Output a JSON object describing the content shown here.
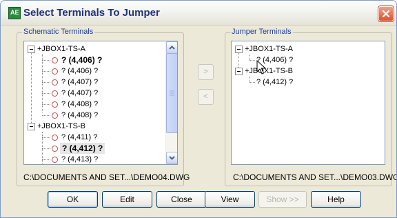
{
  "window": {
    "title": "Select Terminals To Jumper",
    "app_icon_glyph": "AE"
  },
  "schematic": {
    "group_label": "Schematic Terminals",
    "items": [
      {
        "label": "+JBOX1-TS-A",
        "kind": "parent"
      },
      {
        "label": "? (4,406) ?",
        "kind": "child",
        "bold": true
      },
      {
        "label": "? (4,406) ?",
        "kind": "child"
      },
      {
        "label": "? (4,407) ?",
        "kind": "child"
      },
      {
        "label": "? (4,407) ?",
        "kind": "child"
      },
      {
        "label": "? (4,408) ?",
        "kind": "child"
      },
      {
        "label": "? (4,408) ?",
        "kind": "child"
      },
      {
        "label": "+JBOX1-TS-B",
        "kind": "parent"
      },
      {
        "label": "? (4,411) ?",
        "kind": "child"
      },
      {
        "label": "? (4,412) ?",
        "kind": "child",
        "bold": true,
        "selected": true
      },
      {
        "label": "? (4,413) ?",
        "kind": "child"
      }
    ],
    "path": "C:\\DOCUMENTS AND SET...\\DEMO04.DWG"
  },
  "jumper": {
    "group_label": "Jumper Terminals",
    "items": [
      {
        "label": "+JBOX1-TS-A",
        "kind": "parent"
      },
      {
        "label": "? (4,406) ?",
        "kind": "child"
      },
      {
        "label": "+JBOX1-TS-B",
        "kind": "parent"
      },
      {
        "label": "? (4,412) ?",
        "kind": "child"
      }
    ],
    "path": "C:\\DOCUMENTS AND SET...\\DEMO03.DWG"
  },
  "move": {
    "right_glyph": ">",
    "left_glyph": "<"
  },
  "buttons": {
    "ok": "OK",
    "edit": "Edit",
    "close": "Close",
    "view": "View",
    "show": "Show >>",
    "help": "Help"
  },
  "colors": {
    "title_text": "#22337a",
    "group_label": "#1c3b9c",
    "terminal_ring": "#c24a4a",
    "close_button": "#d9532e"
  }
}
